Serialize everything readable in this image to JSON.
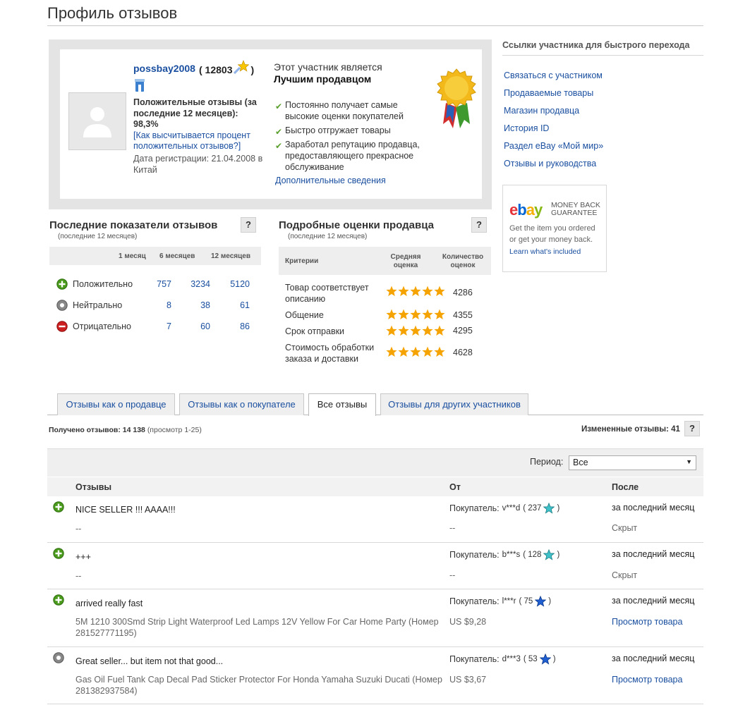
{
  "page_title": "Профиль отзывов",
  "profile": {
    "username": "possbay2008",
    "score_open": "( 12803",
    "score_close": ")",
    "positive_label": "Положительные отзывы (за последние 12 месяцев):",
    "positive_value": "98,3%",
    "positive_howto": "[Как высчитывается процент положительных отзывов?]",
    "registration": "Дата регистрации: 21.04.2008 в Китай",
    "top_seller_line1": "Этот участник является",
    "top_seller_line2": "Лучшим продавцом",
    "checks": [
      "Постоянно получает самые высокие оценки покупателей",
      "Быстро отгружает товары",
      "Заработал репутацию продавца, предоставляющего прекрасное обслуживание"
    ],
    "more_info": "Дополнительные сведения"
  },
  "quick_links": {
    "title": "Ссылки участника для быстрого перехода",
    "items": [
      "Связаться с участником",
      "Продаваемые товары",
      "Магазин продавца",
      "История ID",
      "Раздел eBay «Мой мир»",
      "Отзывы и руководства"
    ]
  },
  "money_back": {
    "logo": [
      "e",
      "b",
      "a",
      "y"
    ],
    "title": "Money back guarantee",
    "line1": "Get the item you ordered",
    "line2": "or get your money back.",
    "link": "Learn what's included"
  },
  "help_label": "?",
  "recent": {
    "title": "Последние показатели отзывов",
    "subtitle": "(последние 12 месяцев)",
    "columns": [
      "1 месяц",
      "6 месяцев",
      "12 месяцев"
    ],
    "rows": [
      {
        "label": "Положительно",
        "values": [
          "757",
          "3234",
          "5120"
        ]
      },
      {
        "label": "Нейтрально",
        "values": [
          "8",
          "38",
          "61"
        ]
      },
      {
        "label": "Отрицательно",
        "values": [
          "7",
          "60",
          "86"
        ]
      }
    ]
  },
  "dsr": {
    "title": "Подробные оценки продавца",
    "subtitle": "(последние 12 месяцев)",
    "columns": [
      "Критерии",
      "Средняя оценка",
      "Количество оценок"
    ],
    "rows": [
      {
        "label": "Товар соответствует описанию",
        "rating": 5,
        "count": "4286"
      },
      {
        "label": "Общение",
        "rating": 5,
        "count": "4355"
      },
      {
        "label": "Срок отправки",
        "rating": 5,
        "count": "4295"
      },
      {
        "label": "Стоимость обработки заказа и доставки",
        "rating": 5,
        "count": "4628"
      }
    ]
  },
  "tabs": [
    "Отзывы как о продавце",
    "Отзывы как о покупателе",
    "Все отзывы",
    "Отзывы для других участников"
  ],
  "received": {
    "label": "Получено отзывов:",
    "count": "14 138",
    "range": "(просмотр 1-25)"
  },
  "changed": {
    "label": "Измененные отзывы:",
    "count": "41"
  },
  "period": {
    "label": "Период:",
    "value": "Все"
  },
  "feedback_table": {
    "columns": [
      "Отзывы",
      "От",
      "После"
    ],
    "rows": [
      {
        "type": "positive",
        "comment": "NICE SELLER !!! AAAA!!!",
        "item": "--",
        "buyer_label": "Покупатель:",
        "buyer": "v***d",
        "buyer_score": "( 237",
        "buyer_close": ")",
        "star": "turquoise",
        "price": "--",
        "when": "за последний месяц",
        "extra": "Скрыт"
      },
      {
        "type": "positive",
        "comment": "+++",
        "item": "--",
        "buyer_label": "Покупатель:",
        "buyer": "b***s",
        "buyer_score": "( 128",
        "buyer_close": ")",
        "star": "turquoise",
        "price": "--",
        "when": "за последний месяц",
        "extra": "Скрыт"
      },
      {
        "type": "positive",
        "comment": "arrived really fast",
        "item": "5M 1210 300Smd Strip Light Waterproof Led Lamps 12V Yellow For Car Home Party (Номер 281527771195)",
        "buyer_label": "Покупатель:",
        "buyer": "l***r",
        "buyer_score": "( 75",
        "buyer_close": ")",
        "star": "blue",
        "price": "US $9,28",
        "when": "за последний месяц",
        "extra": "Просмотр товара"
      },
      {
        "type": "neutral",
        "comment": "Great seller... but item not that good...",
        "item": "Gas Oil Fuel Tank Cap Decal Pad Sticker Protector For Honda Yamaha Suzuki Ducati (Номер 281382937584)",
        "buyer_label": "Покупатель:",
        "buyer": "d***3",
        "buyer_score": "( 53",
        "buyer_close": ")",
        "star": "blue",
        "price": "US $3,67",
        "when": "за последний месяц",
        "extra": "Просмотр товара"
      }
    ]
  },
  "colors": {
    "link": "#1a4fa0",
    "positive": "#4a9a1c",
    "negative": "#cc1f1f",
    "neutral": "#888888",
    "star_orange": "#f5a300",
    "star_turquoise": "#3fc1c9",
    "star_blue": "#1f5fd1",
    "star_yellow": "#f7c600"
  }
}
